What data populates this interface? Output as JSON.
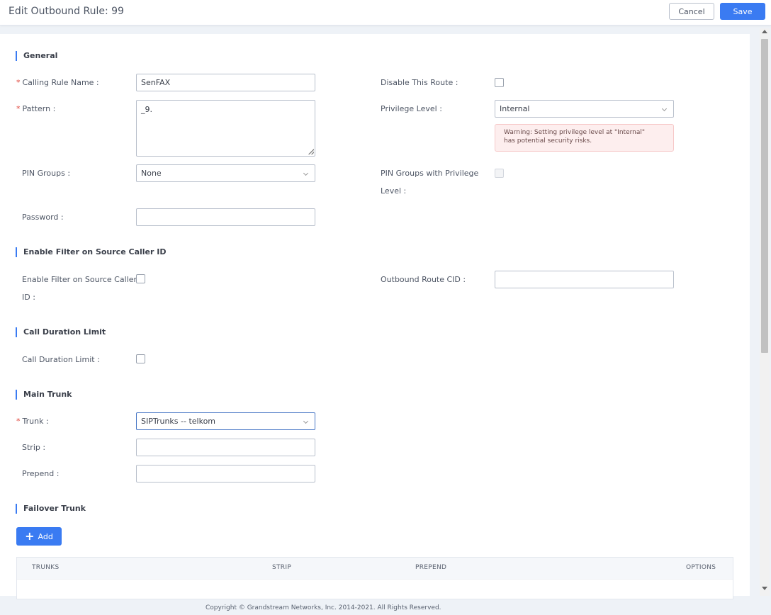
{
  "header": {
    "title": "Edit Outbound Rule: 99",
    "cancel_label": "Cancel",
    "save_label": "Save"
  },
  "sections": {
    "general": "General",
    "filter": "Enable Filter on Source Caller ID",
    "duration": "Call Duration Limit",
    "main_trunk": "Main Trunk",
    "failover": "Failover Trunk"
  },
  "general": {
    "rule_name_label": "Calling Rule Name",
    "rule_name_value": "SenFAX",
    "pattern_label": "Pattern",
    "pattern_value": "_9.",
    "disable_route_label": "Disable This Route",
    "privilege_label": "Privilege Level",
    "privilege_value": "Internal",
    "warning_line1": "Warning: Setting privilege level at \"Internal\"",
    "warning_line2": "has potential security risks.",
    "pin_groups_label": "PIN Groups",
    "pin_groups_value": "None",
    "pin_privilege_label_1": "PIN Groups with Privilege",
    "pin_privilege_label_2": "Level",
    "password_label": "Password",
    "password_value": ""
  },
  "filter": {
    "enable_label_1": "Enable Filter on Source Caller",
    "enable_label_2": "ID",
    "outbound_cid_label": "Outbound Route CID",
    "outbound_cid_value": ""
  },
  "duration": {
    "label": "Call Duration Limit"
  },
  "main_trunk": {
    "trunk_label": "Trunk",
    "trunk_value": "SIPTrunks -- telkom",
    "strip_label": "Strip",
    "strip_value": "",
    "prepend_label": "Prepend",
    "prepend_value": ""
  },
  "failover": {
    "add_label": "Add",
    "columns": [
      "TRUNKS",
      "STRIP",
      "PREPEND",
      "OPTIONS"
    ]
  },
  "footer": {
    "copyright": "Copyright © Grandstream Networks, Inc. 2014-2021. All Rights Reserved."
  },
  "colors": {
    "accent": "#3a7bf2",
    "required": "#e0443a",
    "warning_bg": "#fdeeee"
  }
}
